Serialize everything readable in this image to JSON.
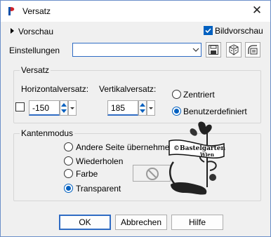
{
  "window": {
    "title": "Versatz"
  },
  "top": {
    "preview_label": "Vorschau",
    "bildvorschau_label": "Bildvorschau",
    "einstellungen_label": "Einstellungen",
    "einstellungen_value": ""
  },
  "versatz": {
    "legend": "Versatz",
    "horizontal_label": "Horizontalversatz:",
    "horizontal_value": "-150",
    "vertikal_label": "Vertikalversatz:",
    "vertikal_value": "185",
    "zentriert_label": "Zentriert",
    "benutzer_label": "Benutzerdefiniert",
    "selected": "Benutzerdefiniert"
  },
  "kanten": {
    "legend": "Kantenmodus",
    "options": [
      "Andere Seite übernehmen",
      "Wiederholen",
      "Farbe",
      "Transparent"
    ],
    "selected": "Transparent"
  },
  "watermark": {
    "line1": "©Bastelgarten",
    "line2": "Wien"
  },
  "buttons": {
    "ok": "OK",
    "cancel": "Abbrechen",
    "help": "Hilfe"
  },
  "colors": {
    "accent": "#0060c0",
    "focus_border": "#2f6cc4"
  }
}
